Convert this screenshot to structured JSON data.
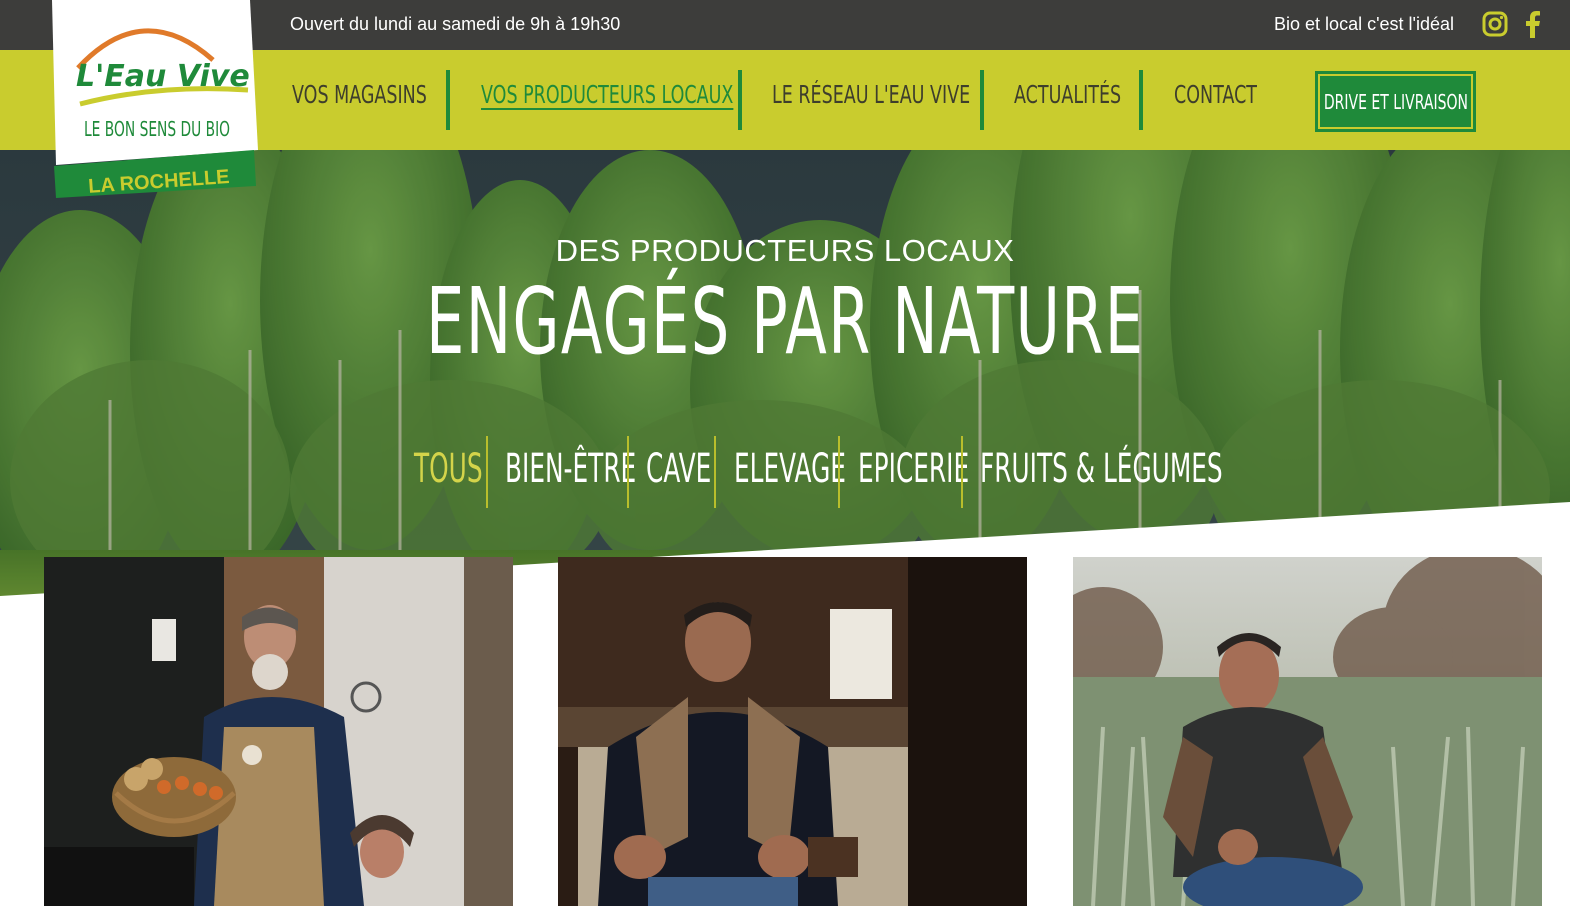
{
  "topbar": {
    "hours": "Ouvert du lundi au samedi de 9h à 19h30",
    "tagline": "Bio et local c'est l'idéal",
    "social": [
      "instagram-icon",
      "facebook-icon"
    ]
  },
  "logo": {
    "brand": "L'Eau Vive",
    "slogan": "LE BON SENS DU BIO",
    "location": "LA ROCHELLE"
  },
  "nav": {
    "items": [
      {
        "label": "VOS MAGASINS",
        "active": false
      },
      {
        "label": "VOS PRODUCTEURS LOCAUX",
        "active": true
      },
      {
        "label": "LE RÉSEAU L'EAU VIVE",
        "active": false
      },
      {
        "label": "ACTUALITÉS",
        "active": false
      },
      {
        "label": "CONTACT",
        "active": false
      }
    ],
    "cta": "DRIVE ET LIVRAISON"
  },
  "hero": {
    "subtitle": "DES PRODUCTEURS LOCAUX",
    "title": "ENGAGÉS PAR NATURE"
  },
  "filters": [
    {
      "label": "TOUS",
      "active": true
    },
    {
      "label": "BIEN-ÊTRE",
      "active": false
    },
    {
      "label": "CAVE",
      "active": false
    },
    {
      "label": "ELEVAGE",
      "active": false
    },
    {
      "label": "EPICERIE",
      "active": false
    },
    {
      "label": "FRUITS & LÉGUMES",
      "active": false
    }
  ],
  "colors": {
    "topbar": "#3d3d3b",
    "navbar": "#c9cc2e",
    "green": "#1f8a3a",
    "filter_active": "#d4d44a"
  }
}
